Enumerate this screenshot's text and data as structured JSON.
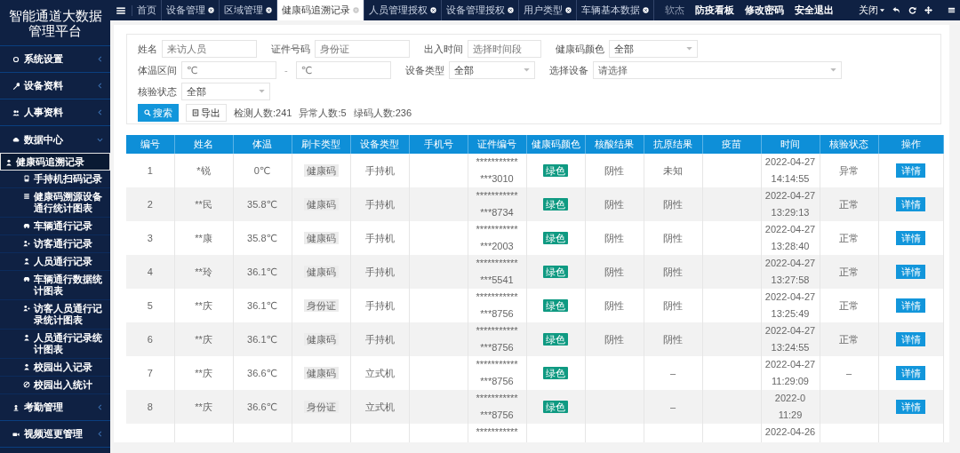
{
  "sidebar": {
    "title": "智能通道大数据管理平台",
    "items": [
      {
        "label": "系统设置",
        "expanded": false
      },
      {
        "label": "设备资料",
        "expanded": false
      },
      {
        "label": "人事资料",
        "expanded": false
      },
      {
        "label": "数据中心",
        "expanded": true,
        "children": [
          {
            "label": "健康码追溯记录",
            "selected": true
          },
          {
            "label": "手持机扫码记录",
            "selected": false
          },
          {
            "label": "健康码溯源设备通行统计图表",
            "selected": false
          },
          {
            "label": "车辆通行记录",
            "selected": false
          },
          {
            "label": "访客通行记录",
            "selected": false
          },
          {
            "label": "人员通行记录",
            "selected": false
          },
          {
            "label": "车辆通行数据统计图表",
            "selected": false
          },
          {
            "label": "访客人员通行记录统计图表",
            "selected": false
          },
          {
            "label": "人员通行记录统计图表",
            "selected": false
          },
          {
            "label": "校园出入记录",
            "selected": false
          },
          {
            "label": "校园出入统计",
            "selected": false
          }
        ]
      },
      {
        "label": "考勤管理",
        "expanded": false
      },
      {
        "label": "视频巡更管理",
        "expanded": false
      }
    ]
  },
  "tabs": [
    {
      "label": "首页",
      "selected": false,
      "closable": false
    },
    {
      "label": "设备管理",
      "selected": false,
      "closable": true
    },
    {
      "label": "区域管理",
      "selected": false,
      "closable": true
    },
    {
      "label": "健康码追溯记录",
      "selected": true,
      "closable": true
    },
    {
      "label": "人员管理授权",
      "selected": false,
      "closable": true
    },
    {
      "label": "设备管理授权",
      "selected": false,
      "closable": true
    },
    {
      "label": "用户类型",
      "selected": false,
      "closable": true
    },
    {
      "label": "车辆基本数据",
      "selected": false,
      "closable": true
    }
  ],
  "top_links": [
    {
      "label": "软杰",
      "disabled": true
    },
    {
      "label": "防疫看板",
      "disabled": false
    },
    {
      "label": "修改密码",
      "disabled": false
    },
    {
      "label": "安全退出",
      "disabled": false
    }
  ],
  "close_menu": "关闭",
  "filters": [
    [
      {
        "kind": "text",
        "label": "姓名",
        "placeholder": "来访人员"
      },
      {
        "kind": "text",
        "label": "证件号码",
        "placeholder": "身份证"
      },
      {
        "kind": "text",
        "label": "出入时间",
        "placeholder": "选择时间段"
      },
      {
        "kind": "select",
        "label": "健康码颜色",
        "value": "全部"
      }
    ],
    [
      {
        "kind": "range",
        "label": "体温区间",
        "placeholder": "℃",
        "separator": "-",
        "placeholder_to": "℃"
      },
      {
        "kind": "select",
        "label": "设备类型",
        "value": "全部"
      },
      {
        "kind": "select",
        "label": "选择设备",
        "placeholder": "请选择"
      }
    ],
    [
      {
        "kind": "select",
        "label": "核验状态",
        "value": "全部"
      }
    ]
  ],
  "buttons": [
    {
      "kind": "search",
      "label": "搜索"
    },
    {
      "kind": "export",
      "label": "导出"
    }
  ],
  "stats": [
    "检测人数:241",
    "异常人数:5",
    "绿码人数:236"
  ],
  "table": {
    "columns": [
      "编号",
      "姓名",
      "体温",
      "刷卡类型",
      "设备类型",
      "手机号",
      "证件编号",
      "健康码颜色",
      "核酸结果",
      "抗原结果",
      "疫苗",
      "时间",
      "核验状态",
      "操作"
    ],
    "rows": [
      {
        "no": "1",
        "name": "*锐",
        "temp": "0℃",
        "card": "健康码",
        "device": "手持机",
        "cert": [
          "***********",
          "***3010"
        ],
        "code": {
          "label": "绿色",
          "color": "#0f9a82"
        },
        "nucleic": "阴性",
        "antigen": "未知",
        "time": [
          "2022-04-27",
          "14:14:55"
        ],
        "status": "异常",
        "action": "详情"
      },
      {
        "no": "2",
        "name": "**民",
        "temp": "35.8℃",
        "card": "健康码",
        "device": "手持机",
        "cert": [
          "***********",
          "***8734"
        ],
        "code": {
          "label": "绿色",
          "color": "#0f9a82"
        },
        "nucleic": "阴性",
        "antigen": "阴性",
        "time": [
          "2022-04-27",
          "13:29:13"
        ],
        "status": "正常",
        "action": "详情"
      },
      {
        "no": "3",
        "name": "**康",
        "temp": "35.8℃",
        "card": "健康码",
        "device": "手持机",
        "cert": [
          "***********",
          "***2003"
        ],
        "code": {
          "label": "绿色",
          "color": "#0f9a82"
        },
        "nucleic": "阴性",
        "antigen": "阴性",
        "time": [
          "2022-04-27",
          "13:28:40"
        ],
        "status": "正常",
        "action": "详情"
      },
      {
        "no": "4",
        "name": "**玲",
        "temp": "36.1℃",
        "card": "健康码",
        "device": "手持机",
        "cert": [
          "***********",
          "***5541"
        ],
        "code": {
          "label": "绿色",
          "color": "#0f9a82"
        },
        "nucleic": "阴性",
        "antigen": "阴性",
        "time": [
          "2022-04-27",
          "13:27:58"
        ],
        "status": "正常",
        "action": "详情"
      },
      {
        "no": "5",
        "name": "**庆",
        "temp": "36.1℃",
        "card": "身份证",
        "device": "手持机",
        "cert": [
          "***********",
          "***8756"
        ],
        "code": {
          "label": "绿色",
          "color": "#0f9a82"
        },
        "nucleic": "阴性",
        "antigen": "阴性",
        "time": [
          "2022-04-27",
          "13:25:49"
        ],
        "status": "正常",
        "action": "详情"
      },
      {
        "no": "6",
        "name": "**庆",
        "temp": "36.1℃",
        "card": "健康码",
        "device": "手持机",
        "cert": [
          "***********",
          "***8756"
        ],
        "code": {
          "label": "绿色",
          "color": "#0f9a82"
        },
        "nucleic": "阴性",
        "antigen": "阴性",
        "time": [
          "2022-04-27",
          "13:24:55"
        ],
        "status": "正常",
        "action": "详情"
      },
      {
        "no": "7",
        "name": "**庆",
        "temp": "36.6℃",
        "card": "健康码",
        "device": "立式机",
        "cert": [
          "***********",
          "***8756"
        ],
        "code": {
          "label": "绿色",
          "color": "#0f9a82"
        },
        "antigen": "–",
        "time": [
          "2022-04-27",
          "11:29:09"
        ],
        "status": "–",
        "action": "详情"
      },
      {
        "no": "8",
        "name": "**庆",
        "temp": "36.6℃",
        "card": "身份证",
        "device": "立式机",
        "cert": [
          "***********",
          "***8756"
        ],
        "code": {
          "label": "绿色",
          "color": "#0f9a82"
        },
        "antigen": "–",
        "time": [
          "2022-0",
          "11:29"
        ],
        "action": "详情"
      },
      {
        "cert": [
          "***********"
        ],
        "time": [
          "2022-04-26"
        ]
      }
    ]
  }
}
